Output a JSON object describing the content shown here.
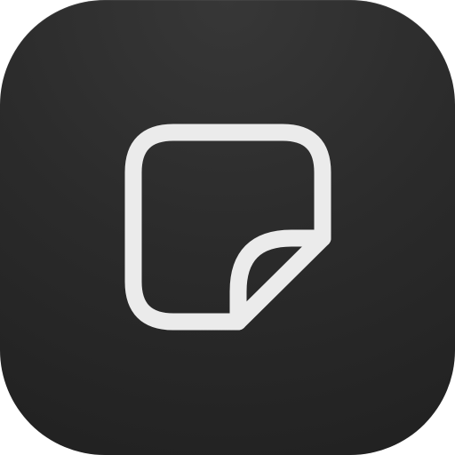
{
  "icon": {
    "name": "sticky-note-icon",
    "tile_color": "#2b2b2b",
    "glyph_color": "#ebebeb"
  }
}
